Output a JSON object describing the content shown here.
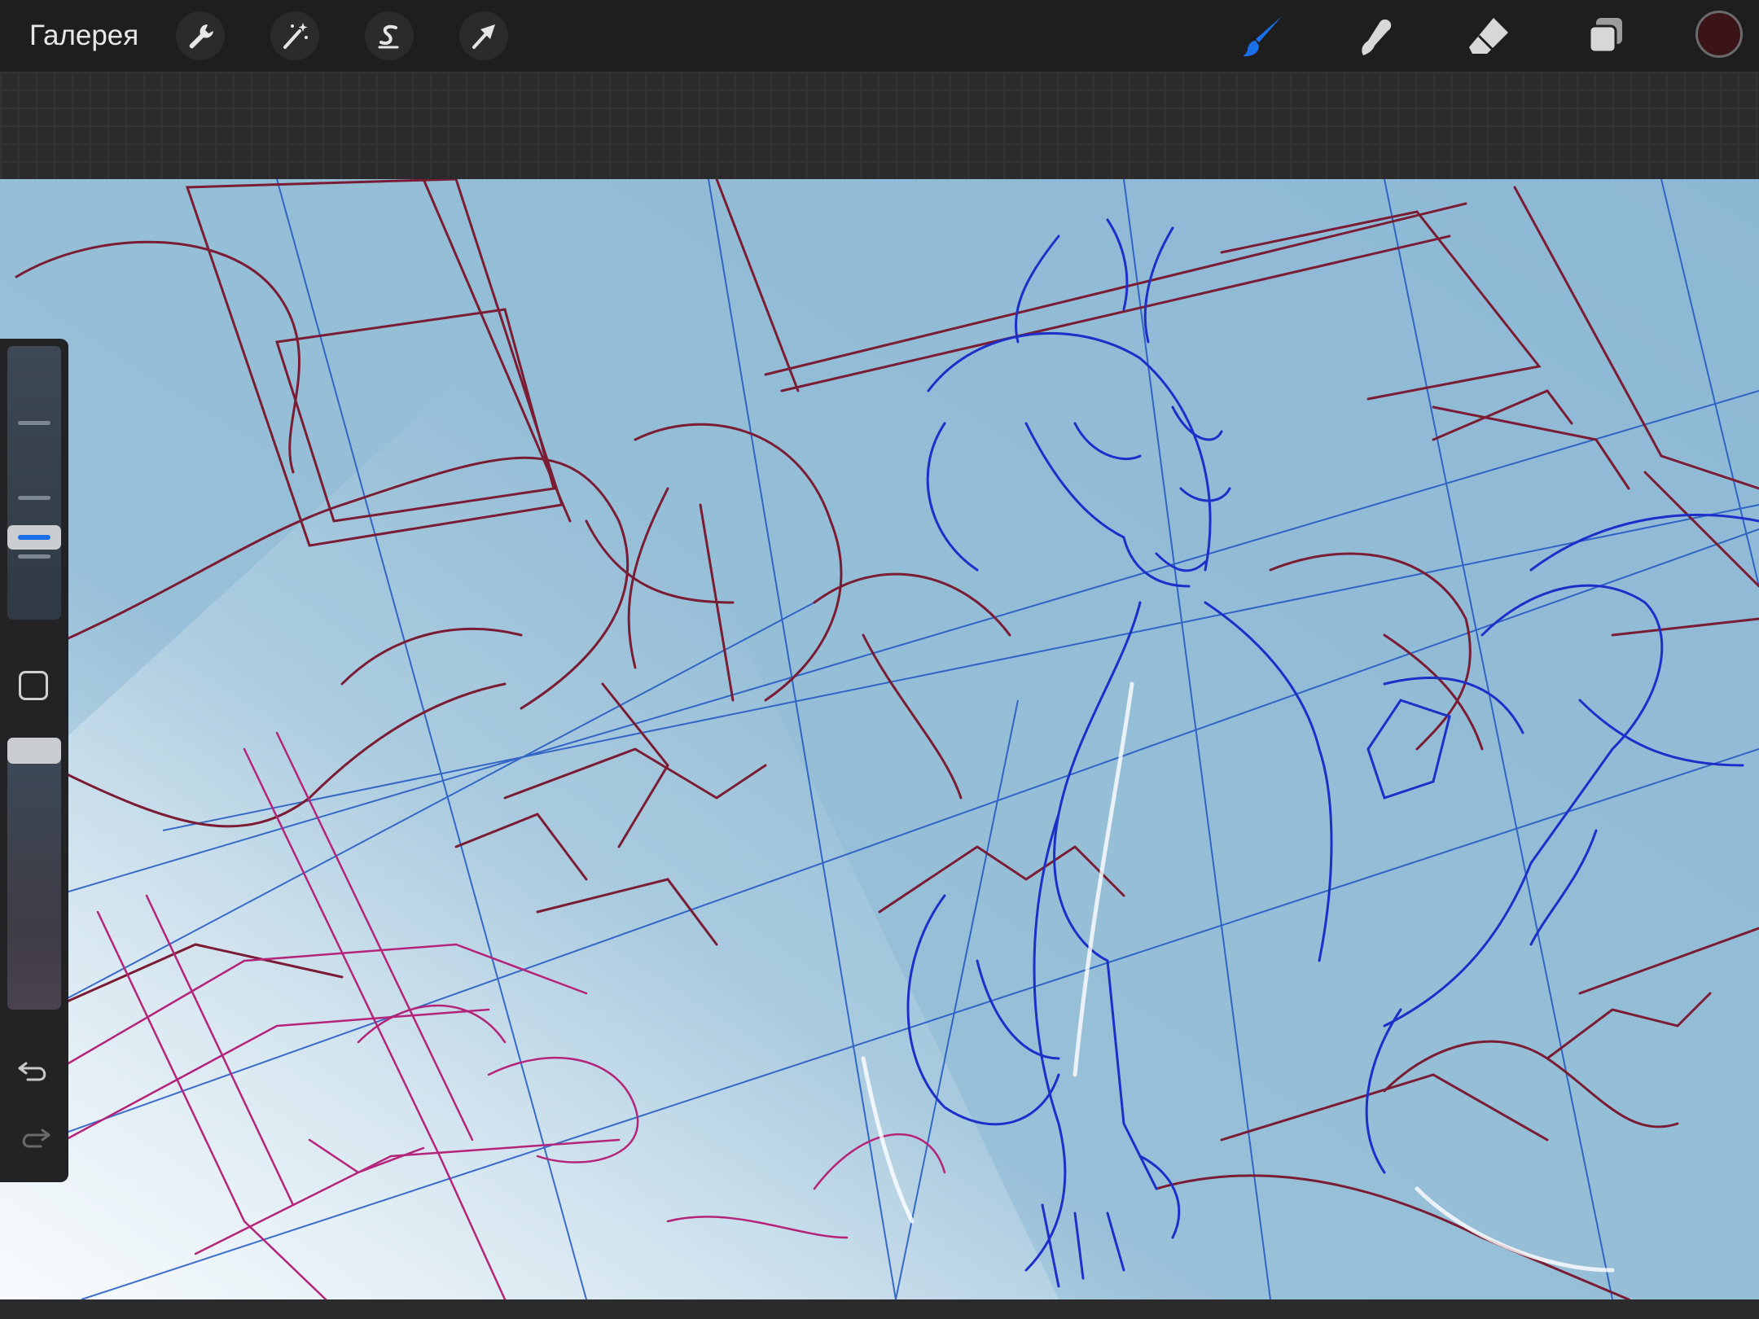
{
  "toolbar": {
    "gallery_label": "Галерея",
    "left_tools": [
      "wrench-icon",
      "magic-wand-icon",
      "selection-s-icon",
      "transform-arrow-icon"
    ],
    "right_tools": [
      "brush-icon",
      "smudge-icon",
      "eraser-icon",
      "layers-icon"
    ],
    "active_tool": "brush-icon",
    "accent_color": "#1a6fe8",
    "current_color": "#3a1416"
  },
  "sidebar": {
    "items": [
      "brush-size-slider",
      "modify-button",
      "opacity-slider",
      "undo-icon",
      "redo-icon"
    ]
  },
  "canvas": {
    "background_color": "#93bcd5",
    "sketch_colors": {
      "background_lines": "#7a1d34",
      "character_lines": "#1d2fc8",
      "perspective_lines": "#1f56c2",
      "foreground_lines": "#b4247a"
    }
  }
}
